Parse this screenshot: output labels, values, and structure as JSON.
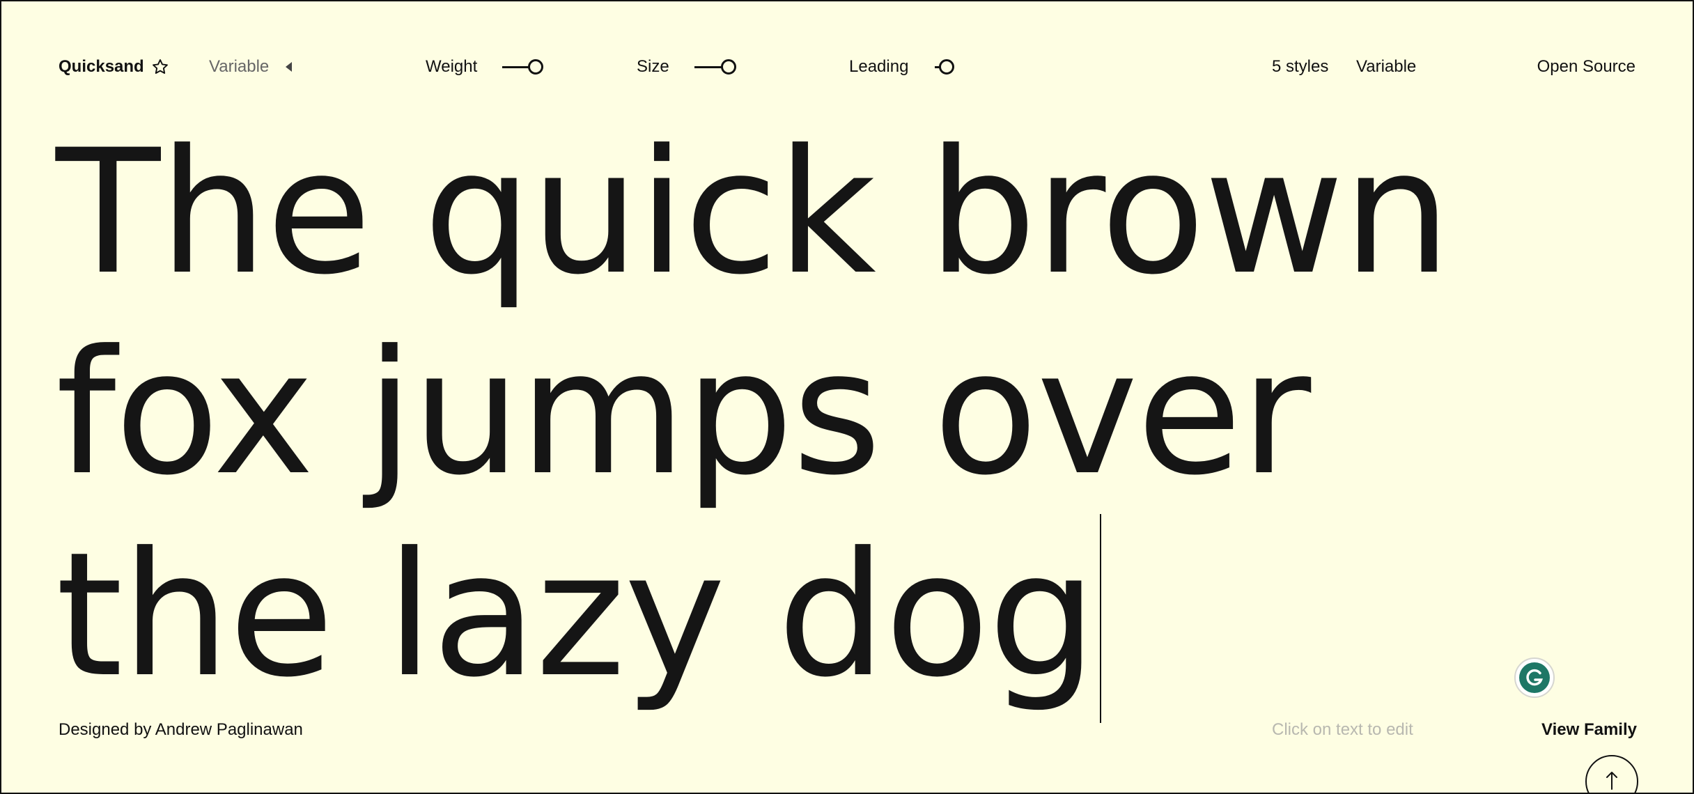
{
  "header": {
    "family_name": "Quicksand",
    "variable_label": "Variable",
    "weight_label": "Weight",
    "weight_value": 0.8,
    "size_label": "Size",
    "size_value": 0.8,
    "leading_label": "Leading",
    "leading_value": 0.3,
    "styles_count": "5 styles",
    "type_label": "Variable",
    "license_label": "Open Source"
  },
  "specimen": {
    "text": "The quick brown fox jumps over the lazy dog"
  },
  "footer": {
    "designer": "Designed by Andrew Paglinawan",
    "edit_hint": "Click on text to edit",
    "view_family": "View Family"
  },
  "colors": {
    "background": "#FEFEE3",
    "ink": "#111111",
    "muted": "#666666",
    "hint": "#B8B8B0",
    "grammarly": "#15C39A"
  },
  "icons": {
    "favorite": "star-outline-icon",
    "variable_toggle": "triangle-left-icon",
    "grammarly": "grammarly-icon",
    "scroll_top": "arrow-up-icon"
  }
}
